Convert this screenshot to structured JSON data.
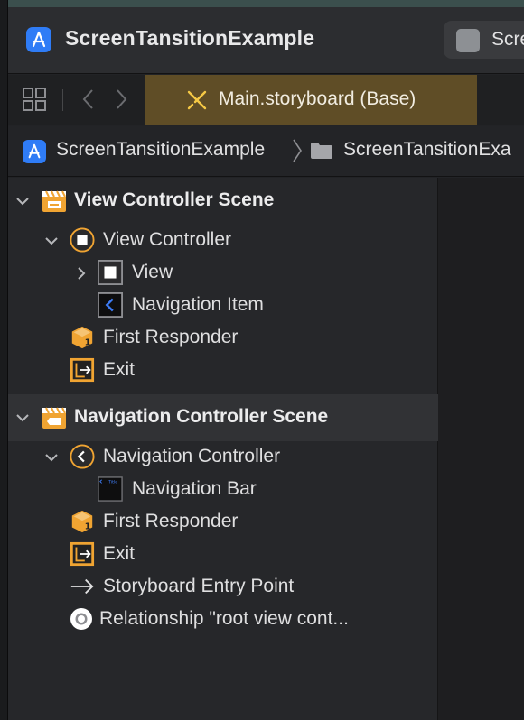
{
  "window": {
    "title": "ScreenTansitionExample",
    "scheme_label": "Scre"
  },
  "tabbar": {
    "active_tab": "Main.storyboard (Base)"
  },
  "jumpbar": {
    "project": "ScreenTansitionExample",
    "folder": "ScreenTansitionExa"
  },
  "outline": {
    "scene1": {
      "title": "View Controller Scene",
      "controller": "View Controller",
      "view": "View",
      "nav_item": "Navigation Item",
      "first_responder": "First Responder",
      "exit": "Exit"
    },
    "scene2": {
      "title": "Navigation Controller Scene",
      "controller": "Navigation Controller",
      "nav_bar": "Navigation Bar",
      "nav_bar_thumb": "Title",
      "first_responder": "First Responder",
      "exit": "Exit",
      "entry_point": "Storyboard Entry Point",
      "relationship": "Relationship \"root view cont..."
    }
  },
  "colors": {
    "accent": "#2f7cf6",
    "tab_active": "#5f4d26",
    "scene_orange": "#f0a432"
  }
}
